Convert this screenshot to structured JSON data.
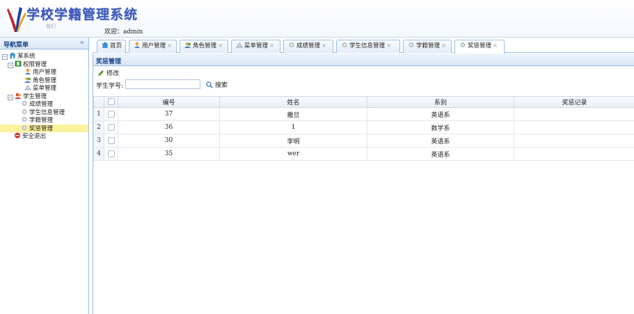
{
  "header": {
    "title": "学校学籍管理系统",
    "subtitle": "我们",
    "welcome": "欢迎：admin"
  },
  "sidebar": {
    "title": "导航菜单",
    "collapse": "«",
    "tree": {
      "root": "某系统",
      "groups": [
        {
          "label": "权限管理",
          "items": [
            "用户管理",
            "角色管理",
            "菜单管理"
          ]
        },
        {
          "label": "学生管理",
          "items": [
            "成绩管理",
            "学生信息管理",
            "学籍管理",
            "奖惩管理"
          ]
        }
      ],
      "logout": "安全退出",
      "selected": "奖惩管理"
    }
  },
  "tabs": [
    {
      "label": "首页",
      "closable": false,
      "icon": "home-icon"
    },
    {
      "label": "用户管理",
      "closable": true,
      "icon": "user-icon"
    },
    {
      "label": "角色管理",
      "closable": true,
      "icon": "users-icon"
    },
    {
      "label": "菜单管理",
      "closable": true,
      "icon": "menu-icon"
    },
    {
      "label": "成绩管理",
      "closable": true,
      "icon": "gear-icon"
    },
    {
      "label": "学生信息管理",
      "closable": true,
      "icon": "gear-icon"
    },
    {
      "label": "学籍管理",
      "closable": true,
      "icon": "gear-icon"
    },
    {
      "label": "奖惩管理",
      "closable": true,
      "icon": "gear-icon",
      "active": true
    }
  ],
  "tab_close": "×",
  "panel": {
    "title": "奖惩管理",
    "edit_label": "修改",
    "search_label": "学生学号:",
    "search_value": "",
    "search_button": "搜索"
  },
  "grid": {
    "columns": [
      "编号",
      "姓名",
      "系别",
      "奖惩记录"
    ],
    "rows": [
      {
        "num": "1",
        "id": "37",
        "name": "撒旦",
        "dept": "英语系",
        "record": ""
      },
      {
        "num": "2",
        "id": "36",
        "name": "1",
        "dept": "数学系",
        "record": ""
      },
      {
        "num": "3",
        "id": "30",
        "name": "李明",
        "dept": "英语系",
        "record": ""
      },
      {
        "num": "4",
        "id": "35",
        "name": "wer",
        "dept": "英语系",
        "record": ""
      }
    ]
  },
  "colors": {
    "accent": "#3b56b7",
    "border": "#99bbe8",
    "selected": "#fdf29c"
  }
}
